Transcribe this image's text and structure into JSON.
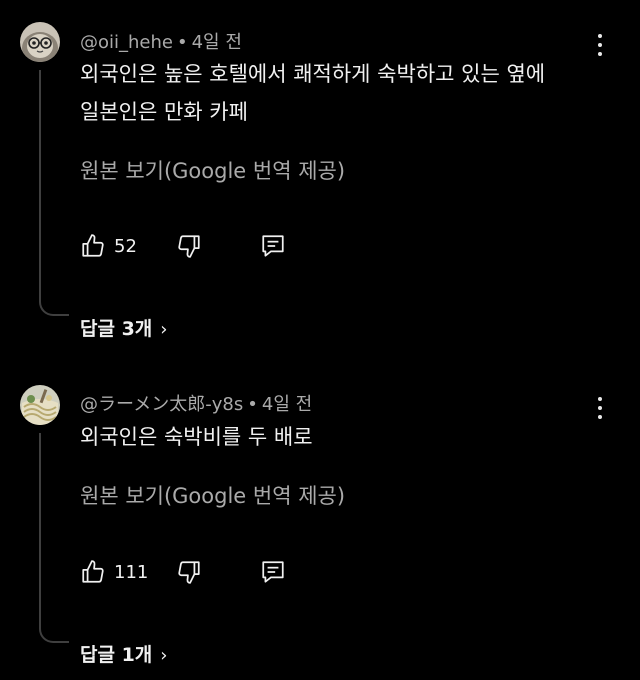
{
  "comments": [
    {
      "author": "@oii_hehe",
      "dot": "•",
      "time": "4일 전",
      "text_line1": "외국인은 높은 호텔에서 쾌적하게 숙박하고 있는 옆에",
      "text_line2": "일본인은 만화 카페",
      "translate_label": "원본 보기(Google 번역 제공)",
      "likes": "52",
      "replies_label": "답글 3개",
      "replies_chevron": "›"
    },
    {
      "author": "@ラーメン太郎-y8s",
      "dot": "•",
      "time": "4일 전",
      "text_line1": "외국인은 숙박비를 두 배로",
      "text_line2": "",
      "translate_label": "원본 보기(Google 번역 제공)",
      "likes": "111",
      "replies_label": "답글 1개",
      "replies_chevron": "›"
    }
  ],
  "icons": {
    "like": "thumbs-up-icon",
    "dislike": "thumbs-down-icon",
    "reply": "reply-icon",
    "more": "more-vert-icon"
  },
  "colors": {
    "background": "#000000",
    "text": "#f1f1f1",
    "secondary": "#aaaaaa",
    "thread": "#3f3f3f"
  }
}
